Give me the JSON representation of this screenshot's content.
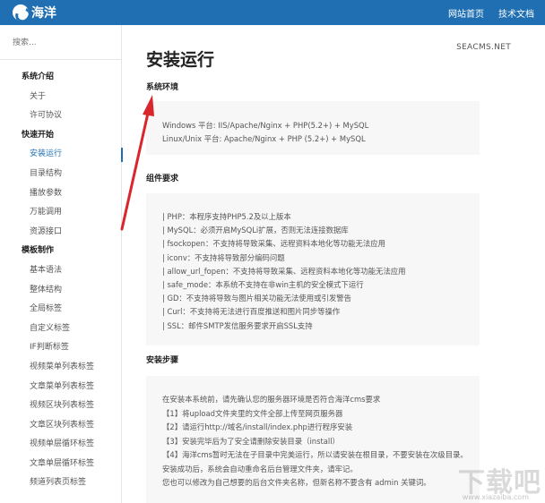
{
  "header": {
    "logo_text": "海洋",
    "nav": [
      "网站首页",
      "技术文档"
    ]
  },
  "sidebar": {
    "search_placeholder": "搜索...",
    "menu": [
      {
        "label": "系统介绍",
        "type": "section"
      },
      {
        "label": "关于",
        "type": "item"
      },
      {
        "label": "许可协议",
        "type": "item"
      },
      {
        "label": "快速开始",
        "type": "section"
      },
      {
        "label": "安装运行",
        "type": "item",
        "active": true
      },
      {
        "label": "目录结构",
        "type": "item"
      },
      {
        "label": "播放参数",
        "type": "item"
      },
      {
        "label": "万能调用",
        "type": "item"
      },
      {
        "label": "资源接口",
        "type": "item"
      },
      {
        "label": "模板制作",
        "type": "section"
      },
      {
        "label": "基本语法",
        "type": "item"
      },
      {
        "label": "整体结构",
        "type": "item"
      },
      {
        "label": "全局标签",
        "type": "item"
      },
      {
        "label": "自定义标签",
        "type": "item"
      },
      {
        "label": "IF判断标签",
        "type": "item"
      },
      {
        "label": "视频菜单列表标签",
        "type": "item"
      },
      {
        "label": "文章菜单列表标签",
        "type": "item"
      },
      {
        "label": "视频区块列表标签",
        "type": "item"
      },
      {
        "label": "文章区块列表标签",
        "type": "item"
      },
      {
        "label": "视频单层循环标签",
        "type": "item"
      },
      {
        "label": "文章单层循环标签",
        "type": "item"
      },
      {
        "label": "频道列表页标签",
        "type": "item"
      }
    ]
  },
  "main": {
    "brand": "SEACMS.NET",
    "title": "安装运行",
    "sections": [
      {
        "heading": "系统环境",
        "lines": [
          "Windows 平台:   IIS/Apache/Nginx + PHP(5.2+) + MySQL",
          "Linux/Unix 平台:   Apache/Nginx + PHP (5.2+) + MySQL"
        ]
      },
      {
        "heading": "组件要求",
        "lines": [
          "| PHP：本程序支持PHP5.2及以上版本",
          "| MySQL：必须开启MySQLi扩展，否则无法连接数据库",
          "| fsockopen：不支持将导致采集、远程资料本地化等功能无法应用",
          "| iconv：不支持将导致部分编码问题",
          "| allow_url_fopen：不支持将导致采集、远程资料本地化等功能无法应用",
          "| safe_mode：本系统不支持在非win主机的安全模式下运行",
          "| GD：不支持将导致与图片相关功能无法使用或引发警告",
          "| Curl：不支持将无法进行百度推送和图片同步等操作",
          "| SSL：邮件SMTP发信服务要求开启SSL支持"
        ]
      },
      {
        "heading": "安装步骤",
        "lines": [
          "在安装本系统前，请先确认您的服务器环境是否符合海洋cms要求",
          "【1】将upload文件夹里的文件全部上传至网页服务器",
          "【2】请运行http://域名/install/index.php进行程序安装",
          "【3】安装完毕后为了安全请删除安装目录（install）",
          "【4】海洋cms暂时无法在子目录中完美运行，所以请安装在根目录，不要安装在次级目录。",
          "安装成功后，系统会自动重命名后台管理文件夹，请牢记。",
          "您也可以修改为自己想要的后台文件夹名称，但新名称不要含有 admin 关键词。"
        ]
      }
    ]
  },
  "annotation": {
    "color": "#d9262c"
  },
  "watermark": {
    "text": "下载吧",
    "url": "www.xiazaiba.com"
  },
  "colors": {
    "accent": "#1f6fb2",
    "box_bg": "#f7f7f7"
  }
}
